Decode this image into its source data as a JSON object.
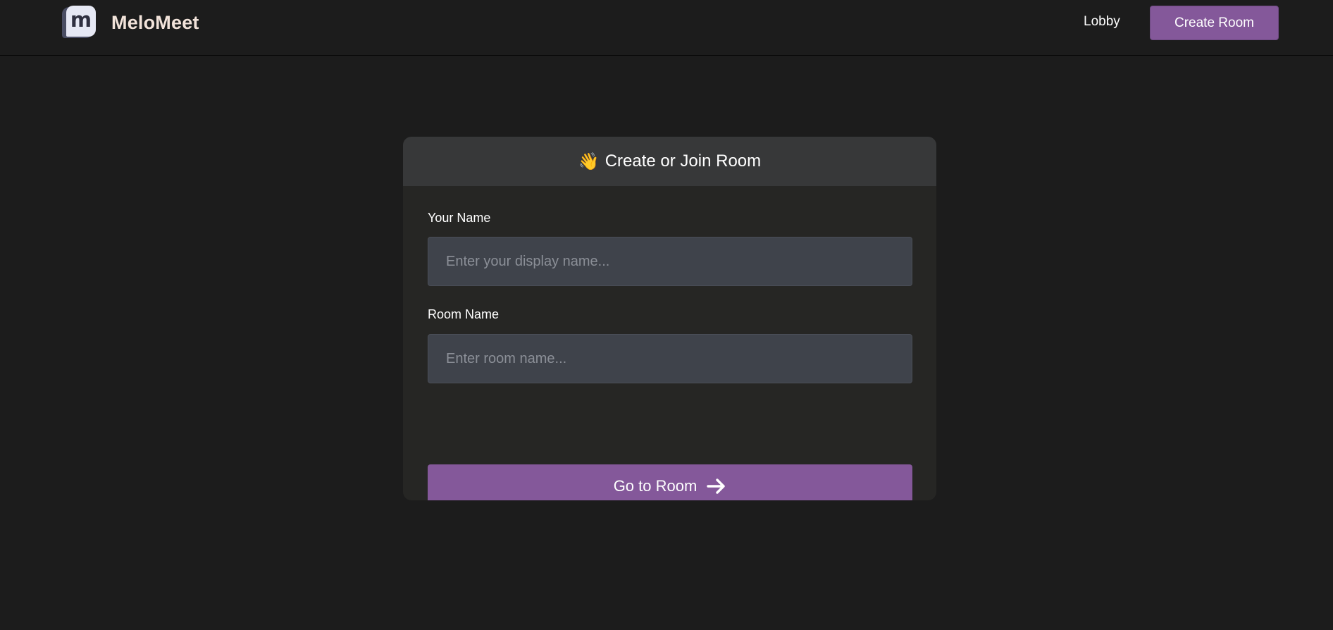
{
  "brand": {
    "name": "MeloMeet",
    "logo_letter": "m"
  },
  "nav": {
    "lobby_label": "Lobby",
    "create_room_label": "Create Room"
  },
  "card": {
    "header_icon": "👋",
    "title": "Create or Join Room",
    "name_label": "Your Name",
    "name_value": "",
    "name_placeholder": "Enter your display name...",
    "room_label": "Room Name",
    "room_value": "",
    "room_placeholder": "Enter room name...",
    "submit_label": "Go to Room",
    "submit_icon": "arrow-right-icon"
  },
  "colors": {
    "background": "#1c1c1c",
    "card": "#262624",
    "card_header": "#373839",
    "input": "#3f434b",
    "accent": "#84589a",
    "brand_text": "#f2e3da"
  }
}
